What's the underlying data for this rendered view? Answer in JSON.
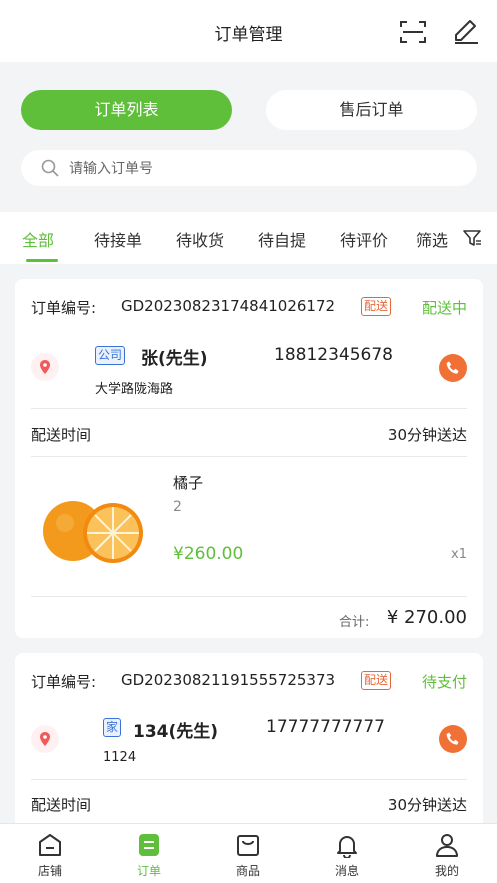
{
  "header": {
    "title": "订单管理",
    "scan_icon": "scan-icon",
    "edit_icon": "edit-icon"
  },
  "segments": {
    "active": "订单列表",
    "inactive": "售后订单"
  },
  "search": {
    "placeholder": "请输入订单号"
  },
  "tabs": [
    "全部",
    "待接单",
    "待收货",
    "待自提",
    "待评价",
    "筛选"
  ],
  "orders": [
    {
      "label": "订单编号:",
      "number": "GD20230823174841026172",
      "badge": "配送",
      "status": "配送中",
      "addr_tag": "公司",
      "name": "张(先生)",
      "phone": "18812345678",
      "address": "大学路陇海路",
      "delivery_label": "配送时间",
      "delivery_value": "30分钟送达",
      "product": {
        "name": "橘子",
        "spec": "2",
        "price": "¥260.00",
        "qty": "x1"
      },
      "total_label": "合计:",
      "total_value": "¥ 270.00"
    },
    {
      "label": "订单编号:",
      "number": "GD20230821191555725373",
      "badge": "配送",
      "status": "待支付",
      "addr_tag": "家",
      "name": "134(先生)",
      "phone": "17777777777",
      "address": "1124",
      "delivery_label": "配送时间",
      "delivery_value": "30分钟送达"
    }
  ],
  "nav": [
    {
      "label": "店铺",
      "icon": "store-icon"
    },
    {
      "label": "订单",
      "icon": "order-icon"
    },
    {
      "label": "商品",
      "icon": "goods-bag-icon"
    },
    {
      "label": "消息",
      "icon": "bell-icon"
    },
    {
      "label": "我的",
      "icon": "user-icon"
    }
  ],
  "colors": {
    "accent": "#5fbf3b",
    "badge": "#e5683a",
    "phone": "#f07035",
    "tag": "#3a73d8"
  }
}
